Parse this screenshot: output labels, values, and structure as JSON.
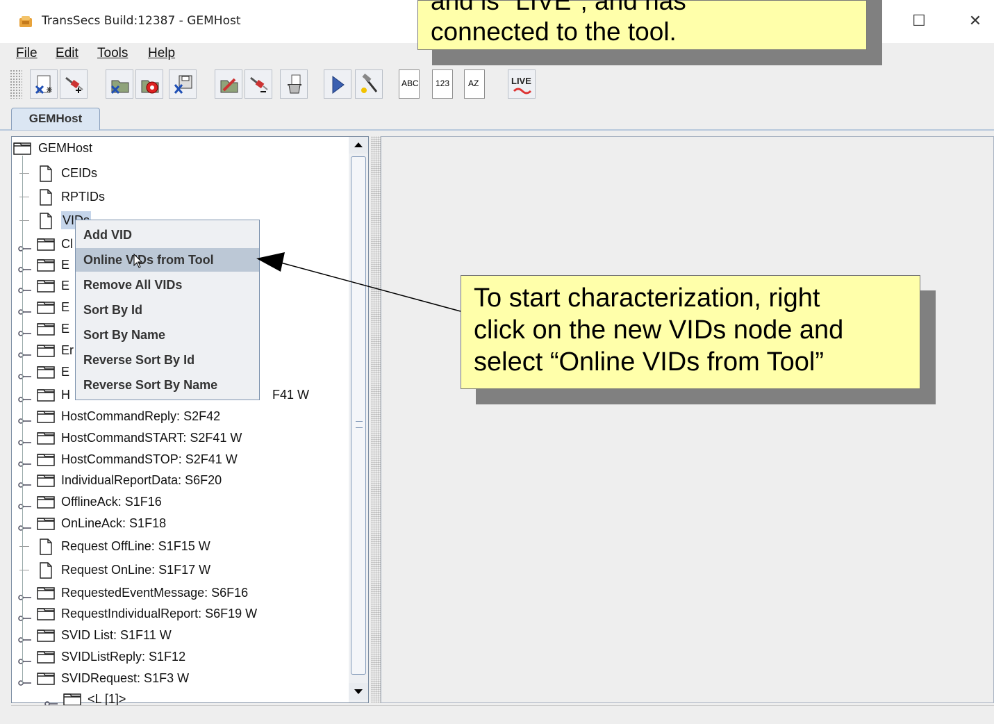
{
  "window": {
    "title": "TransSecs Build:12387 - GEMHost",
    "maximize_glyph": "☐",
    "close_glyph": "✕"
  },
  "menu": [
    "File",
    "Edit",
    "Tools",
    "Help"
  ],
  "toolbar": {
    "text_buttons": [
      {
        "icon": "abc-format-icon",
        "text": "ABC"
      },
      {
        "icon": "numeric-format-icon",
        "text": "123"
      },
      {
        "icon": "sort-az-icon",
        "text": "AZ"
      }
    ],
    "live_label": "LIVE"
  },
  "tab": {
    "label": "GEMHost"
  },
  "tree": {
    "root": "GEMHost",
    "items": [
      {
        "label": "CEIDs",
        "kind": "doc"
      },
      {
        "label": "RPTIDs",
        "kind": "doc"
      },
      {
        "label": "VIDs",
        "kind": "doc",
        "selected": true
      },
      {
        "label": "Cl",
        "kind": "folder"
      },
      {
        "label": "E",
        "kind": "folder"
      },
      {
        "label": "E",
        "kind": "folder"
      },
      {
        "label": "E",
        "kind": "folder"
      },
      {
        "label": "E",
        "kind": "folder"
      },
      {
        "label": "Er",
        "kind": "folder"
      },
      {
        "label": "E",
        "kind": "folder"
      },
      {
        "label": "H",
        "kind": "folder",
        "suffix": "F41 W"
      },
      {
        "label": "HostCommandReply: S2F42",
        "kind": "folder"
      },
      {
        "label": "HostCommandSTART: S2F41 W",
        "kind": "folder"
      },
      {
        "label": "HostCommandSTOP: S2F41 W",
        "kind": "folder"
      },
      {
        "label": "IndividualReportData: S6F20",
        "kind": "folder"
      },
      {
        "label": "OfflineAck: S1F16",
        "kind": "folder"
      },
      {
        "label": "OnLineAck: S1F18",
        "kind": "folder"
      },
      {
        "label": "Request OffLine: S1F15 W",
        "kind": "doc"
      },
      {
        "label": "Request OnLine: S1F17 W",
        "kind": "doc"
      },
      {
        "label": "RequestedEventMessage: S6F16",
        "kind": "folder"
      },
      {
        "label": "RequestIndividualReport: S6F19 W",
        "kind": "folder"
      },
      {
        "label": "SVID List: S1F11 W",
        "kind": "folder"
      },
      {
        "label": "SVIDListReply: S1F12",
        "kind": "folder"
      },
      {
        "label": "SVIDRequest: S1F3 W",
        "kind": "folder",
        "expanded": true
      },
      {
        "label": "<L [1]>",
        "kind": "folder",
        "child": true
      }
    ]
  },
  "context_menu": {
    "items": [
      "Add VID",
      "Online VIDs from Tool",
      "Remove All VIDs",
      "Sort By Id",
      "Sort By Name",
      "Reverse Sort By Id",
      "Reverse Sort By Name"
    ],
    "highlighted_index": 1
  },
  "callouts": {
    "top_lines": [
      "and is \"LIVE\", and has",
      "connected to the tool."
    ],
    "right_lines": [
      "To start characterization, right",
      "click on the new VIDs node and",
      "select “Online VIDs from Tool”"
    ],
    "fill_color": "#ffffaa"
  }
}
